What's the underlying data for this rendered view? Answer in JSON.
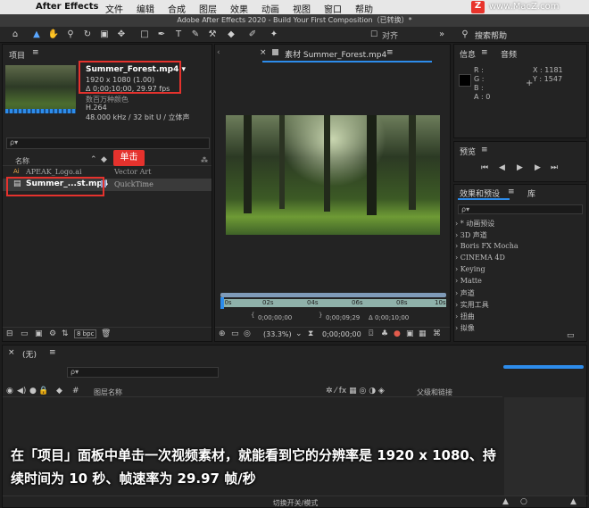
{
  "menubar": {
    "app": "After Effects",
    "items": [
      "文件",
      "编辑",
      "合成",
      "图层",
      "效果",
      "动画",
      "视图",
      "窗口",
      "帮助"
    ],
    "watermark": "www.MacZ.com"
  },
  "window_title": "Adobe After Effects 2020 - Build Your First Composition（已转换）*",
  "toolbar": {
    "align_label": "对齐",
    "search_help": "搜索帮助"
  },
  "project": {
    "title": "项目",
    "file_name": "Summer_Forest.mp4 ▾",
    "resolution": "1920 x 1080 (1.00)",
    "duration_fps": "Δ 0;00;10;00, 29.97 fps",
    "extra_line": "数百万种颜色",
    "codec": "H.264",
    "audio": "48.000 kHz / 32 bit U / 立体声",
    "search_placeholder": "ρ▾",
    "col_name": "名称",
    "rows": [
      {
        "name": "APEAK_Logo.ai",
        "type": "Vector Art"
      },
      {
        "name": "Summer_...st.mp4",
        "type": "QuickTime"
      }
    ],
    "tooltip": "单击",
    "bpc": "8 bpc"
  },
  "viewer": {
    "tab": "素材 Summer_Forest.mp4",
    "ruler_labels": [
      "00s",
      "02s",
      "04s",
      "06s",
      "08s",
      "10s"
    ],
    "time_in": "0;00;00;00",
    "time_dur": "0;00;09;29",
    "time_delta": "Δ 0;00;10;00",
    "zoom": "(33.3%)",
    "current_time": "0;00;00;00"
  },
  "info": {
    "tab_info": "信息",
    "tab_audio": "音频",
    "r": "R :",
    "g": "G :",
    "b": "B :",
    "a": "A : 0",
    "x": "X : 1181",
    "y": "Y : 1547"
  },
  "preview": {
    "title": "预览"
  },
  "effects": {
    "tab": "效果和预设",
    "tab2": "库",
    "search_placeholder": "ρ▾",
    "items": [
      "* 动画预设",
      "3D 声道",
      "Boris FX Mocha",
      "CINEMA 4D",
      "Keying",
      "Matte",
      "声道",
      "实用工具",
      "扭曲",
      "拟像"
    ]
  },
  "timeline": {
    "tab": "(无)",
    "col_layer": "图层名称",
    "col_parent": "父级和链接",
    "bottom_label": "切换开关/模式"
  },
  "caption": {
    "line1": "在「项目」面板中单击一次视频素材，就能看到它的分辨率是 1920 x 1080、持",
    "line2": "续时间为 10 秒、帧速率为 29.97 帧/秒"
  },
  "colors": {
    "accent": "#2d8ceb",
    "highlight_box": "#e5322d",
    "caption_text": "#ffffff"
  }
}
